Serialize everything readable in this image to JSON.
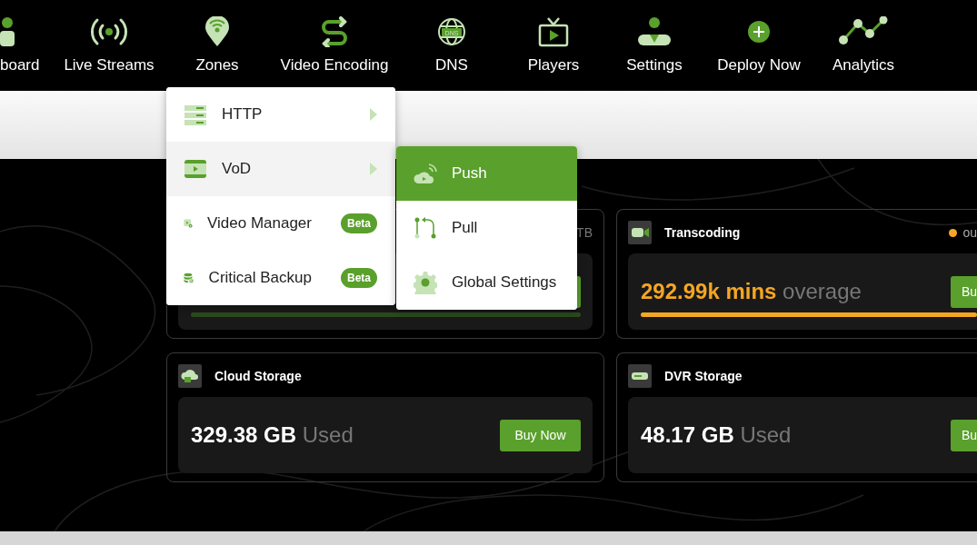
{
  "nav": {
    "items": [
      {
        "label": "board"
      },
      {
        "label": "Live Streams"
      },
      {
        "label": "Zones"
      },
      {
        "label": "Video Encoding"
      },
      {
        "label": "DNS",
        "icon_text": "DNS"
      },
      {
        "label": "Players"
      },
      {
        "label": "Settings"
      },
      {
        "label": "Deploy Now"
      },
      {
        "label": "Analytics"
      }
    ]
  },
  "menu": {
    "items": [
      {
        "label": "HTTP",
        "submenu": true,
        "selected": false
      },
      {
        "label": "VoD",
        "submenu": true,
        "selected": true
      },
      {
        "label": "Video Manager",
        "badge": "Beta",
        "submenu": false,
        "selected": false
      },
      {
        "label": "Critical Backup",
        "badge": "Beta",
        "submenu": false,
        "selected": false
      }
    ]
  },
  "submenu": {
    "items": [
      {
        "label": "Push",
        "selected": true
      },
      {
        "label": "Pull",
        "selected": false
      },
      {
        "label": "Global Settings",
        "selected": false
      }
    ]
  },
  "cards": [
    {
      "header_right": "TB",
      "warning": false,
      "level": 1
    },
    {
      "title": "Transcoding",
      "status": "ou",
      "color": "#f5a623",
      "value": "292.99k mins",
      "unit": "overage",
      "button": "Bu",
      "warning": true,
      "level": 1
    },
    {
      "title": "Cloud Storage",
      "value": "329.38 GB",
      "unit": "Used",
      "button": "Buy Now",
      "warning": false
    },
    {
      "title": "DVR Storage",
      "value": "48.17 GB",
      "unit": "Used",
      "button": "Bu",
      "warning": false
    }
  ]
}
